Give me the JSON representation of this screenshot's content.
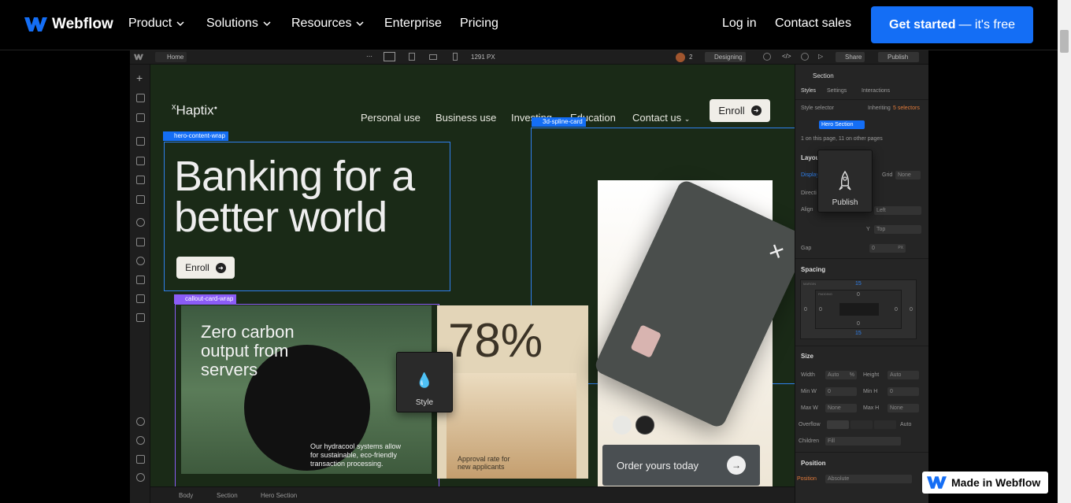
{
  "site": {
    "brand": "Webflow",
    "nav": [
      "Product",
      "Solutions",
      "Resources",
      "Enterprise",
      "Pricing"
    ],
    "login": "Log in",
    "contact": "Contact sales",
    "cta_main": "Get started",
    "cta_light": "— it's free",
    "made_in": "Made in Webflow"
  },
  "designer": {
    "topbar": {
      "page": "Home",
      "width": "1291 PX",
      "collaborators": "2",
      "mode": "Designing",
      "share": "Share",
      "publish": "Publish"
    },
    "breadcrumb": [
      "Body",
      "Section",
      "Hero Section"
    ],
    "canvas": {
      "brand": "Haptix",
      "brand_prefix": "x",
      "nav": [
        "Personal use",
        "Business use",
        "Investing",
        "Education",
        "Contact us"
      ],
      "enroll": "Enroll",
      "hero_line1": "Banking for a",
      "hero_line2": "better world",
      "hero_enroll": "Enroll",
      "tag_hero": "hero-content-wrap",
      "tag_callout": "callout-card-wrap",
      "tag_spline": "3d-spline-card",
      "callout_title_1": "Zero carbon",
      "callout_title_2": "output from",
      "callout_title_3": "servers",
      "callout_body_1": "Our hydracool systems allow",
      "callout_body_2": "for sustainable, eco-friendly",
      "callout_body_3": "transaction processing.",
      "stat": "78%",
      "stat_label_1": "Approval rate for",
      "stat_label_2": "new applicants",
      "order": "Order yours today",
      "tooltip_style": "Style",
      "tooltip_publish": "Publish"
    },
    "panel": {
      "element": "Section",
      "tabs": [
        "Styles",
        "Settings",
        "Interactions"
      ],
      "style_selector": "Style selector",
      "inheriting": "Inheriting",
      "inheriting_count": "5 selectors",
      "class": "Hero Section",
      "on_page": "1 on this page, 11 on other pages",
      "layout": "Layout",
      "display": "Display",
      "direction": "Directi",
      "align": "Align",
      "grid": "Grid",
      "none": "None",
      "left": "Left",
      "y": "Y",
      "top": "Top",
      "gap": "Gap",
      "gap_val": "0",
      "px": "PX",
      "spacing": "Spacing",
      "margin_label": "MARGIN",
      "padding_label": "PADDING",
      "spacing_top": "15",
      "spacing_bottom": "15",
      "zero": "0",
      "size": "Size",
      "width": "Width",
      "height": "Height",
      "auto": "Auto",
      "pct": "%",
      "min_w": "Min W",
      "min_h": "Min H",
      "max_w": "Max W",
      "max_h": "Max H",
      "overflow": "Overflow",
      "children": "Children",
      "fill": "Fill",
      "position": "Position",
      "position_label": "Position",
      "absolute": "Absolute"
    }
  },
  "colors": {
    "accent": "#146ef5",
    "purple": "#8b5cf6",
    "canvas_bg": "#1a2a17"
  }
}
